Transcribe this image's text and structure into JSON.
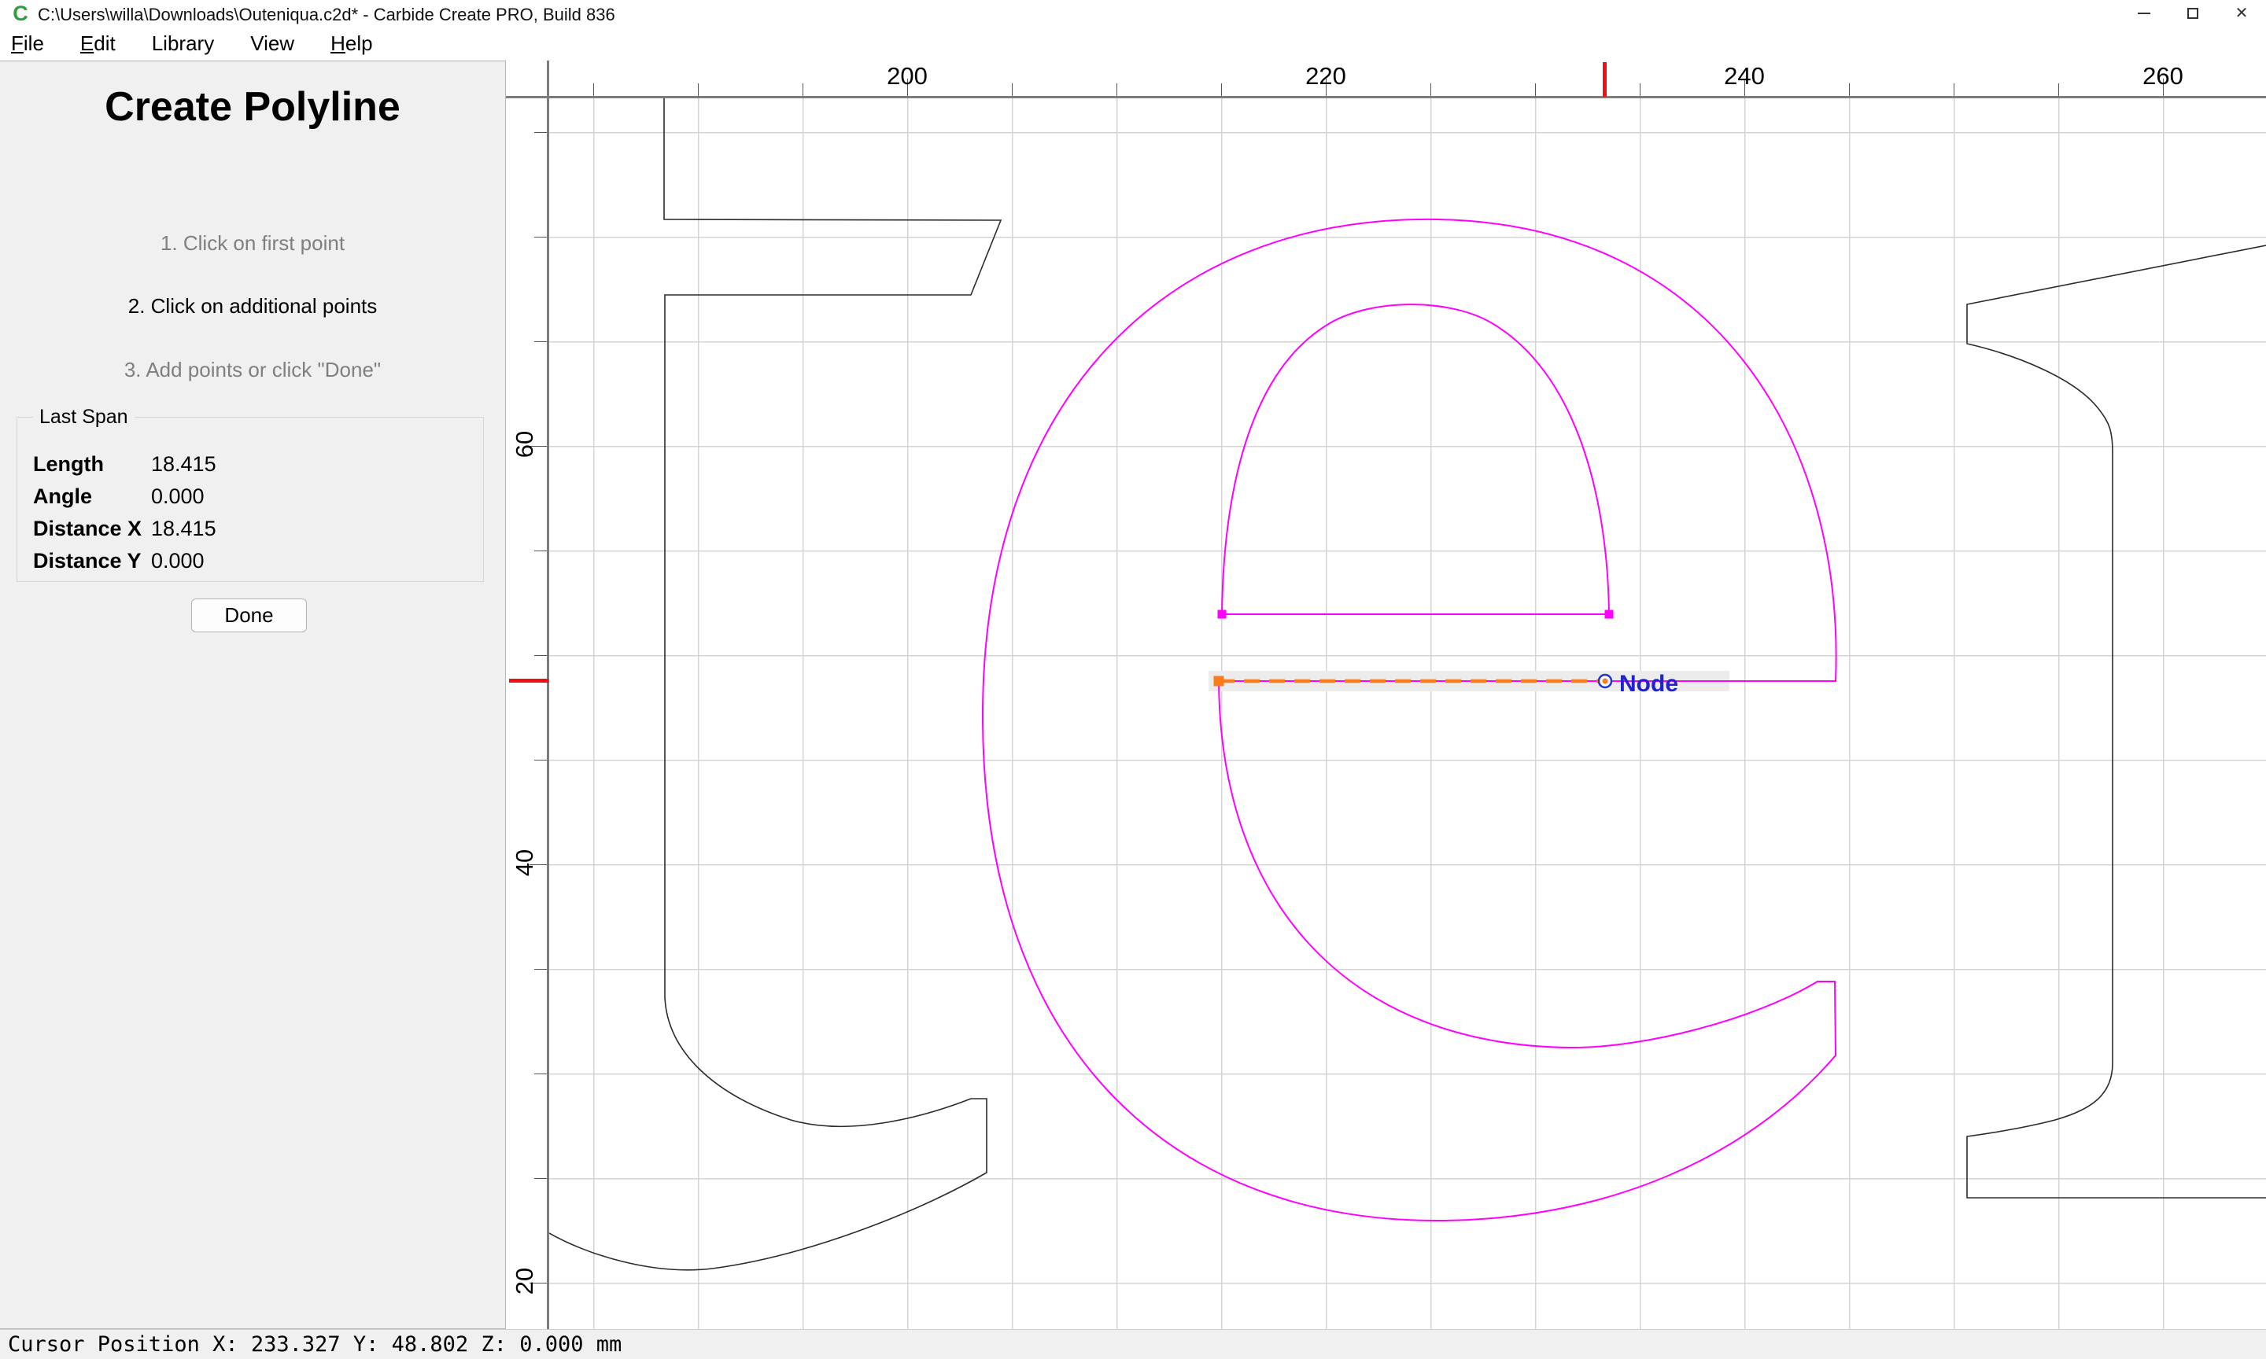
{
  "window": {
    "icon": "carbide-create-logo",
    "icon_glyph": "C",
    "title": "C:\\Users\\willa\\Downloads\\Outeniqua.c2d* - Carbide Create PRO, Build 836"
  },
  "menu": {
    "items": [
      {
        "label": "File",
        "underline_first": true
      },
      {
        "label": "Edit",
        "underline_first": true
      },
      {
        "label": "Library",
        "underline_first": false
      },
      {
        "label": "View",
        "underline_first": false
      },
      {
        "label": "Help",
        "underline_first": true
      }
    ]
  },
  "tool_panel": {
    "title": "Create Polyline",
    "steps": [
      {
        "text": "1. Click on first point",
        "active": false
      },
      {
        "text": "2. Click on additional points",
        "active": true
      },
      {
        "text": "3. Add points or click \"Done\"",
        "active": false
      }
    ],
    "last_span": {
      "label": "Last Span",
      "rows": [
        {
          "label": "Length",
          "value": "18.415"
        },
        {
          "label": "Angle",
          "value": "0.000"
        },
        {
          "label": "Distance X",
          "value": "18.415"
        },
        {
          "label": "Distance Y",
          "value": "0.000"
        }
      ]
    },
    "done_button": "Done"
  },
  "rulers": {
    "horizontal": {
      "unit_labels_mm": [
        200,
        220,
        240,
        260
      ],
      "cursor_marker_mm": 233.327
    },
    "vertical": {
      "unit_labels_mm": [
        60,
        40,
        20
      ],
      "cursor_marker_mm": 48.802
    },
    "marker_color": "#ee1111"
  },
  "canvas": {
    "node_label": "Node",
    "colors": {
      "selected_vector": "#ff00ff",
      "unselected_vector": "#2b2b2b",
      "polyline_preview": "#f97c1d",
      "node_label_color": "#2222cc",
      "grid": "#d4d4d4"
    }
  },
  "status_bar": {
    "text": "Cursor Position X: 233.327 Y: 48.802 Z: 0.000 mm"
  }
}
